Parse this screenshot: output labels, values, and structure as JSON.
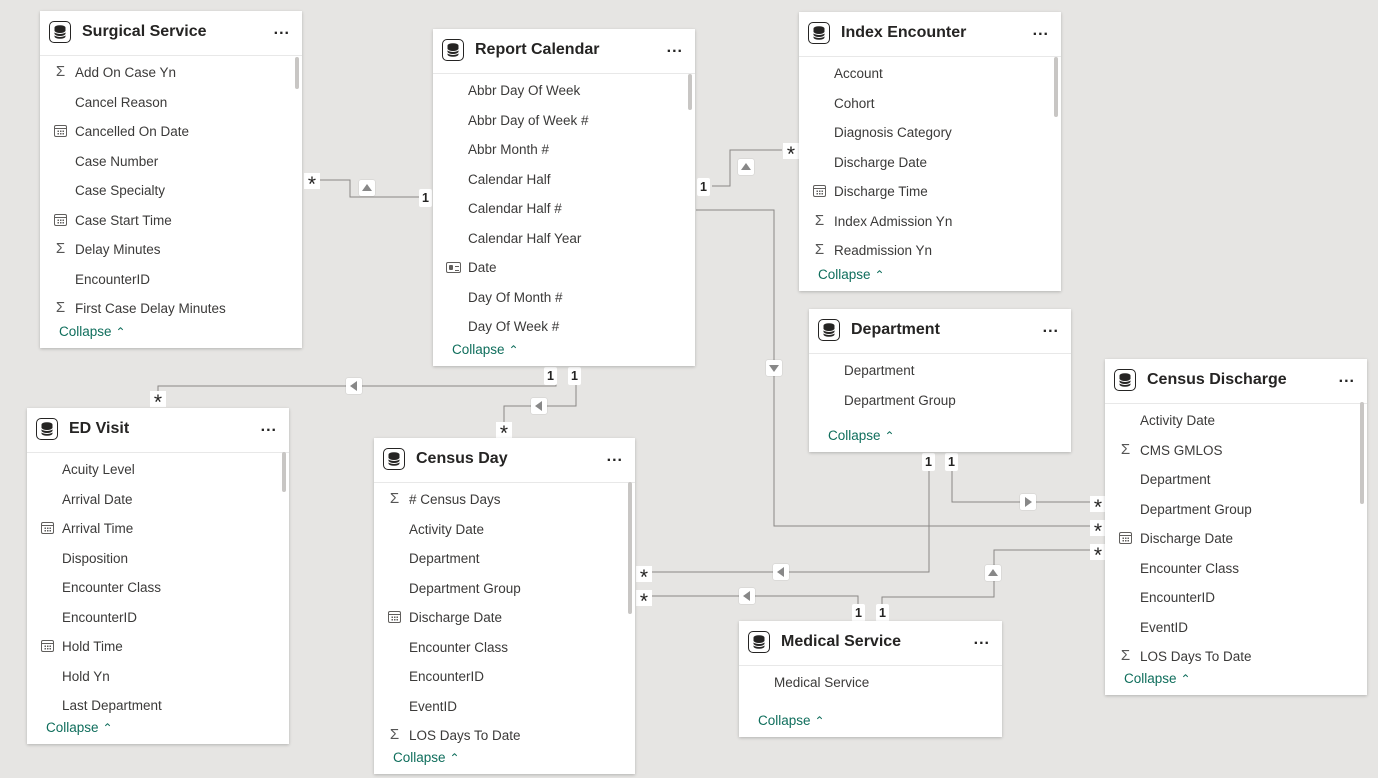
{
  "tables": {
    "surgical_service": {
      "title": "Surgical Service",
      "more": "...",
      "fields": [
        {
          "name": "Add On Case Yn",
          "icon": "sigma-icon"
        },
        {
          "name": "Cancel Reason",
          "icon": ""
        },
        {
          "name": "Cancelled On Date",
          "icon": "calendar-icon"
        },
        {
          "name": "Case Number",
          "icon": ""
        },
        {
          "name": "Case Specialty",
          "icon": ""
        },
        {
          "name": "Case Start Time",
          "icon": "calendar-icon"
        },
        {
          "name": "Delay Minutes",
          "icon": "sigma-icon"
        },
        {
          "name": "EncounterID",
          "icon": ""
        },
        {
          "name": "First Case Delay Minutes",
          "icon": "sigma-icon"
        }
      ],
      "collapse": "Collapse"
    },
    "report_calendar": {
      "title": "Report Calendar",
      "more": "...",
      "fields": [
        {
          "name": "Abbr Day Of Week",
          "icon": ""
        },
        {
          "name": "Abbr Day of Week #",
          "icon": ""
        },
        {
          "name": "Abbr Month #",
          "icon": ""
        },
        {
          "name": "Calendar Half",
          "icon": ""
        },
        {
          "name": "Calendar Half #",
          "icon": ""
        },
        {
          "name": "Calendar Half Year",
          "icon": ""
        },
        {
          "name": "Date",
          "icon": "id-card-icon"
        },
        {
          "name": "Day Of Month #",
          "icon": ""
        },
        {
          "name": "Day Of Week #",
          "icon": ""
        }
      ],
      "collapse": "Collapse"
    },
    "index_encounter": {
      "title": "Index Encounter",
      "more": "...",
      "fields": [
        {
          "name": "Account",
          "icon": ""
        },
        {
          "name": "Cohort",
          "icon": ""
        },
        {
          "name": "Diagnosis Category",
          "icon": ""
        },
        {
          "name": "Discharge Date",
          "icon": ""
        },
        {
          "name": "Discharge Time",
          "icon": "calendar-icon"
        },
        {
          "name": "Index Admission Yn",
          "icon": "sigma-icon"
        },
        {
          "name": "Readmission Yn",
          "icon": "sigma-icon"
        }
      ],
      "collapse": "Collapse"
    },
    "department": {
      "title": "Department",
      "more": "...",
      "fields": [
        {
          "name": "Department",
          "icon": ""
        },
        {
          "name": "Department Group",
          "icon": ""
        }
      ],
      "collapse": "Collapse"
    },
    "census_discharge": {
      "title": "Census Discharge",
      "more": "...",
      "fields": [
        {
          "name": "Activity Date",
          "icon": ""
        },
        {
          "name": "CMS GMLOS",
          "icon": "sigma-icon"
        },
        {
          "name": "Department",
          "icon": ""
        },
        {
          "name": "Department Group",
          "icon": ""
        },
        {
          "name": "Discharge Date",
          "icon": "calendar-icon"
        },
        {
          "name": "Encounter Class",
          "icon": ""
        },
        {
          "name": "EncounterID",
          "icon": ""
        },
        {
          "name": "EventID",
          "icon": ""
        },
        {
          "name": "LOS Days To Date",
          "icon": "sigma-icon"
        }
      ],
      "collapse": "Collapse"
    },
    "ed_visit": {
      "title": "ED Visit",
      "more": "...",
      "fields": [
        {
          "name": "Acuity Level",
          "icon": ""
        },
        {
          "name": "Arrival Date",
          "icon": ""
        },
        {
          "name": "Arrival Time",
          "icon": "calendar-icon"
        },
        {
          "name": "Disposition",
          "icon": ""
        },
        {
          "name": "Encounter Class",
          "icon": ""
        },
        {
          "name": "EncounterID",
          "icon": ""
        },
        {
          "name": "Hold Time",
          "icon": "calendar-icon"
        },
        {
          "name": "Hold Yn",
          "icon": ""
        },
        {
          "name": "Last Department",
          "icon": ""
        }
      ],
      "collapse": "Collapse"
    },
    "census_day": {
      "title": "Census Day",
      "more": "...",
      "fields": [
        {
          "name": "# Census Days",
          "icon": "sigma-icon"
        },
        {
          "name": "Activity Date",
          "icon": ""
        },
        {
          "name": "Department",
          "icon": ""
        },
        {
          "name": "Department Group",
          "icon": ""
        },
        {
          "name": "Discharge Date",
          "icon": "calendar-icon"
        },
        {
          "name": "Encounter Class",
          "icon": ""
        },
        {
          "name": "EncounterID",
          "icon": ""
        },
        {
          "name": "EventID",
          "icon": ""
        },
        {
          "name": "LOS Days To Date",
          "icon": "sigma-icon"
        }
      ],
      "collapse": "Collapse"
    },
    "medical_service": {
      "title": "Medical Service",
      "more": "...",
      "fields": [
        {
          "name": "Medical Service",
          "icon": ""
        }
      ],
      "collapse": "Collapse"
    }
  },
  "cardinality": {
    "one": "1",
    "many": "*"
  }
}
